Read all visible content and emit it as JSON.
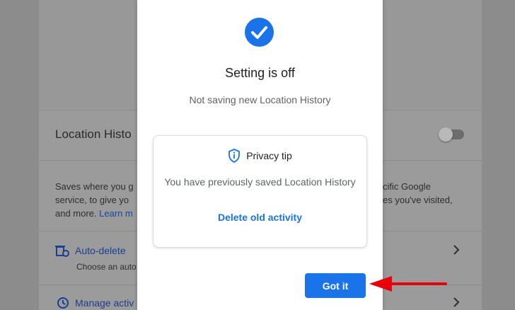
{
  "background": {
    "location_history_label": "Location Histo",
    "description_left": [
      "Saves where you g",
      "service, to give yo",
      "and more. "
    ],
    "learn_more": "Learn m",
    "description_right": [
      "cific Google",
      "es you've visited,"
    ],
    "auto_delete_label": "Auto-delete",
    "auto_delete_sub": "Choose an auto",
    "manage_activity_label": "Manage activ"
  },
  "dialog": {
    "title": "Setting is off",
    "subtitle": "Not saving new Location History",
    "tip": {
      "heading": "Privacy tip",
      "text": "You have previously saved Location History",
      "link": "Delete old activity"
    },
    "confirm_button": "Got it"
  },
  "colors": {
    "accent": "#1a73e8",
    "annotation_arrow": "#e8000b"
  },
  "icons": [
    "check-icon",
    "shield-icon",
    "auto-delete-icon",
    "history-icon",
    "chevron-right-icon",
    "arrow-annotation"
  ]
}
